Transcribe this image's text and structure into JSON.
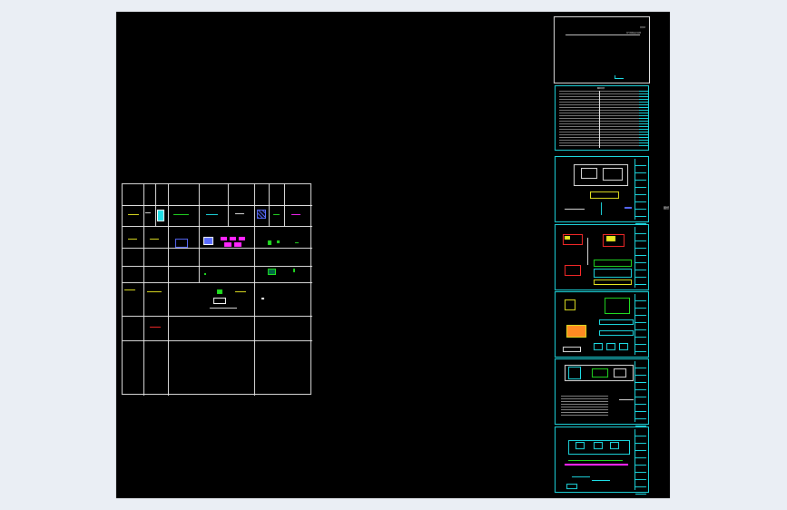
{
  "viewport": {
    "background": "#eaeef4",
    "model_space": "#000000"
  },
  "colors": {
    "cyan": "#1ee0e8",
    "white": "#e6e6e6",
    "magenta": "#ff26ff",
    "green": "#22e022",
    "yellow": "#e8e822",
    "red": "#ff2a2a",
    "blue": "#5a6cff"
  },
  "cover_sheet": {
    "title_small": "某某机",
    "title_main": "电气控制设计说明",
    "note": ""
  },
  "index_sheet": {
    "header": "图纸目录"
  },
  "drawing_sheets": [
    {
      "id": "sheet-3"
    },
    {
      "id": "sheet-4"
    },
    {
      "id": "sheet-5"
    },
    {
      "id": "sheet-6"
    },
    {
      "id": "sheet-7"
    }
  ],
  "right_tag": "图纸"
}
